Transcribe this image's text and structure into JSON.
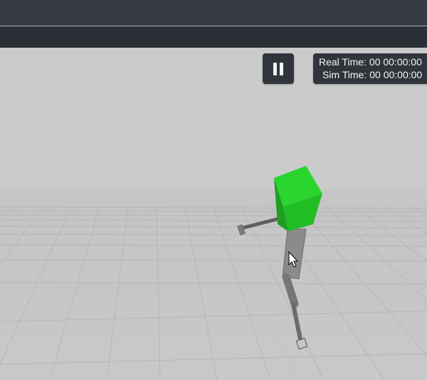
{
  "toolbar": {
    "pause_button_icon": "pause-icon"
  },
  "time_panel": {
    "real_time_label": "Real Time:",
    "real_time_value": "00 00:00:00",
    "sim_time_label": "Sim Time:",
    "sim_time_value": "00 00:00:00"
  },
  "scene": {
    "robot_head_color": "#26cf2a",
    "floor_color": "#c9c9c9",
    "sky_color": "#cbcbcb",
    "robot_limb_color": "#777777"
  },
  "cursor_icon": "mouse-pointer-icon"
}
